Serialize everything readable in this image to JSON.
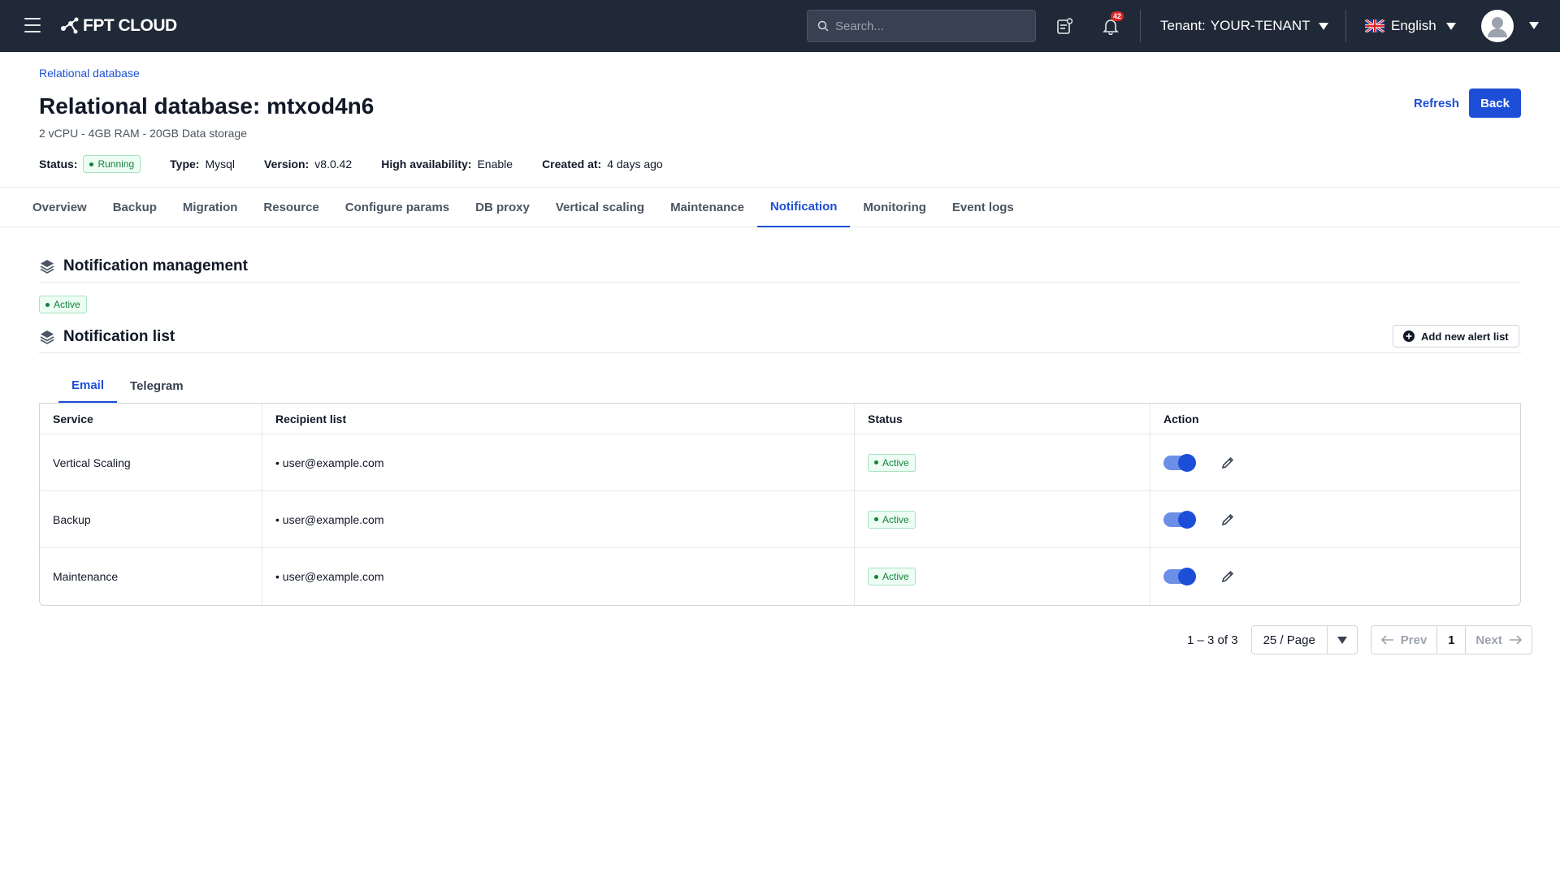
{
  "topbar": {
    "logo": "FPT CLOUD",
    "search_placeholder": "Search...",
    "notification_count": "42",
    "tenant_label": "Tenant:",
    "tenant_value": "YOUR-TENANT",
    "language": "English"
  },
  "header": {
    "breadcrumb": "Relational database",
    "title": "Relational database: mtxod4n6",
    "subtitle": "2 vCPU - 4GB RAM - 20GB Data storage",
    "refresh_label": "Refresh",
    "back_label": "Back",
    "meta": {
      "status_label": "Status:",
      "status_value": "Running",
      "type_label": "Type:",
      "type_value": "Mysql",
      "version_label": "Version:",
      "version_value": "v8.0.42",
      "ha_label": "High availability:",
      "ha_value": "Enable",
      "created_label": "Created at:",
      "created_value": "4 days ago"
    }
  },
  "tabs": [
    "Overview",
    "Backup",
    "Migration",
    "Resource",
    "Configure params",
    "DB proxy",
    "Vertical scaling",
    "Maintenance",
    "Notification",
    "Monitoring",
    "Event logs"
  ],
  "active_tab": "Notification",
  "notification_management": {
    "title": "Notification management",
    "status": "Active"
  },
  "notification_list": {
    "title": "Notification list",
    "add_label": "Add new alert list",
    "subtabs": [
      "Email",
      "Telegram"
    ],
    "active_subtab": "Email",
    "columns": [
      "Service",
      "Recipient list",
      "Status",
      "Action"
    ],
    "rows": [
      {
        "service": "Vertical Scaling",
        "recipient": "user@example.com",
        "status": "Active",
        "enabled": true
      },
      {
        "service": "Backup",
        "recipient": "user@example.com",
        "status": "Active",
        "enabled": true
      },
      {
        "service": "Maintenance",
        "recipient": "user@example.com",
        "status": "Active",
        "enabled": true
      }
    ]
  },
  "pagination": {
    "range": "1 – 3 of 3",
    "page_size": "25 / Page",
    "prev_label": "Prev",
    "next_label": "Next",
    "current_page": "1"
  },
  "colors": {
    "topbar_bg": "#1f2937",
    "primary": "#1d4ed8",
    "success": "#15803d",
    "badge": "#dc2626"
  }
}
